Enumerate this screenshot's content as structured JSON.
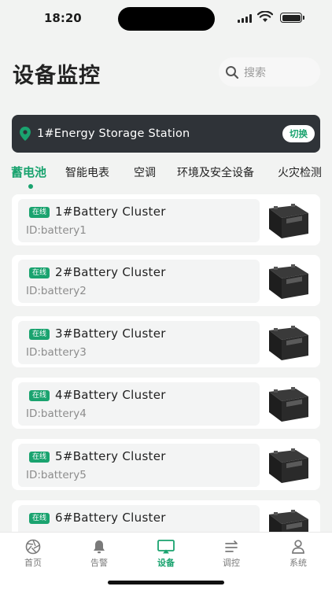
{
  "status_bar": {
    "time": "18:20"
  },
  "header": {
    "title": "设备监控",
    "search_placeholder": "搜索"
  },
  "station": {
    "name": "1#Energy Storage Station",
    "switch_label": "切换"
  },
  "tabs": [
    {
      "label": "蓄电池",
      "active": true
    },
    {
      "label": "智能电表",
      "active": false
    },
    {
      "label": "空调",
      "active": false
    },
    {
      "label": "环境及安全设备",
      "active": false
    },
    {
      "label": "火灾检测",
      "active": false
    }
  ],
  "devices": [
    {
      "status": "在线",
      "name": "1#Battery Cluster",
      "id": "ID:battery1"
    },
    {
      "status": "在线",
      "name": "2#Battery Cluster",
      "id": "ID:battery2"
    },
    {
      "status": "在线",
      "name": "3#Battery Cluster",
      "id": "ID:battery3"
    },
    {
      "status": "在线",
      "name": "4#Battery Cluster",
      "id": "ID:battery4"
    },
    {
      "status": "在线",
      "name": "5#Battery Cluster",
      "id": "ID:battery5"
    },
    {
      "status": "在线",
      "name": "6#Battery Cluster",
      "id": ""
    }
  ],
  "tabbar": [
    {
      "label": "首页",
      "icon": "aperture-icon",
      "active": false
    },
    {
      "label": "告警",
      "icon": "bell-icon",
      "active": false
    },
    {
      "label": "设备",
      "icon": "monitor-icon",
      "active": true
    },
    {
      "label": "调控",
      "icon": "control-icon",
      "active": false
    },
    {
      "label": "系统",
      "icon": "user-icon",
      "active": false
    }
  ],
  "colors": {
    "accent": "#1aa36f",
    "station_bg": "#2f3338",
    "page_bg": "#f2f3f2"
  }
}
